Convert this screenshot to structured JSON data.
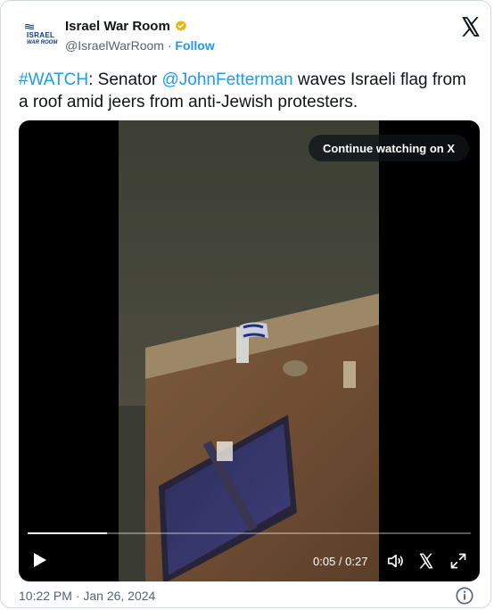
{
  "account": {
    "display_name": "Israel War Room",
    "handle": "@IsraelWarRoom",
    "separator": " · ",
    "follow_label": "Follow",
    "avatar_text_line1": "ISRAEL",
    "avatar_text_line2": "WAR ROOM"
  },
  "tweet": {
    "hashtag": "#WATCH",
    "text_part1": ": Senator ",
    "mention": "@JohnFetterman",
    "text_part2": " waves Israeli flag from a roof amid jeers from anti-Jewish protesters."
  },
  "video": {
    "continue_label": "Continue watching on X",
    "current_time": "0:05",
    "duration": "0:27",
    "time_separator": " / ",
    "progress_fraction": 0.18
  },
  "footer": {
    "timestamp": "10:22 PM · Jan 26, 2024"
  },
  "icons": {
    "verified": "verified-badge-icon",
    "x_logo": "x-logo-icon",
    "play": "play-icon",
    "volume": "volume-icon",
    "x_small": "x-logo-icon",
    "expand": "expand-icon",
    "info": "info-icon"
  },
  "colors": {
    "link": "#1d9bf0",
    "verified_gold": "#e2b719",
    "text_primary": "#0f1419",
    "text_secondary": "#536471"
  }
}
